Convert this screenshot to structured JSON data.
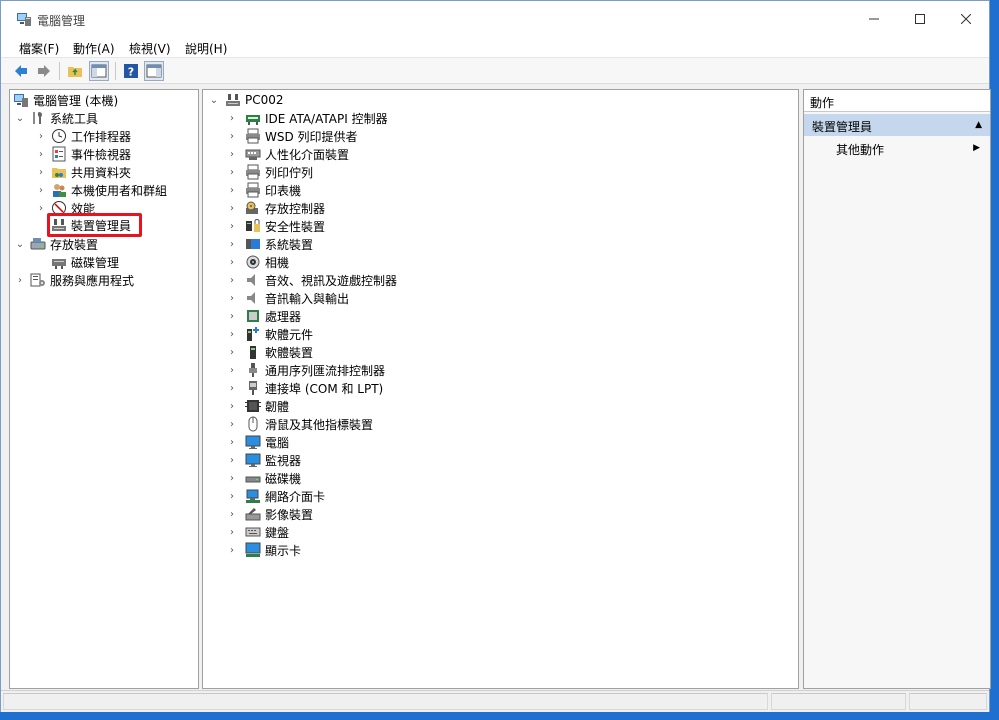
{
  "window": {
    "title": "電腦管理"
  },
  "menu": [
    "檔案(F)",
    "動作(A)",
    "檢視(V)",
    "說明(H)"
  ],
  "toolbar": {
    "buttons": [
      "back-icon",
      "forward-icon",
      "up-folder-icon",
      "show-hide-tree-icon",
      "help-icon",
      "show-hide-action-pane-icon"
    ]
  },
  "tree": {
    "root": "電腦管理 (本機)",
    "system_tools": "系統工具",
    "task_scheduler": "工作排程器",
    "event_viewer": "事件檢視器",
    "shared_folders": "共用資料夾",
    "local_users": "本機使用者和群組",
    "performance": "效能",
    "device_manager": "裝置管理員",
    "storage": "存放裝置",
    "disk_management": "磁碟管理",
    "services_apps": "服務與應用程式"
  },
  "devices": {
    "computer": "PC002",
    "items": [
      {
        "label": "IDE ATA/ATAPI 控制器",
        "icon": "ide-controller-icon"
      },
      {
        "label": "WSD 列印提供者",
        "icon": "printer-icon"
      },
      {
        "label": "人性化介面裝置",
        "icon": "hid-icon"
      },
      {
        "label": "列印佇列",
        "icon": "printer-icon"
      },
      {
        "label": "印表機",
        "icon": "printer-icon"
      },
      {
        "label": "存放控制器",
        "icon": "storage-controller-icon"
      },
      {
        "label": "安全性裝置",
        "icon": "security-device-icon"
      },
      {
        "label": "系統裝置",
        "icon": "system-device-icon"
      },
      {
        "label": "相機",
        "icon": "camera-icon"
      },
      {
        "label": "音效、視訊及遊戲控制器",
        "icon": "speaker-icon"
      },
      {
        "label": "音訊輸入與輸出",
        "icon": "speaker-icon"
      },
      {
        "label": "處理器",
        "icon": "processor-icon"
      },
      {
        "label": "軟體元件",
        "icon": "software-component-icon"
      },
      {
        "label": "軟體裝置",
        "icon": "software-device-icon"
      },
      {
        "label": "通用序列匯流排控制器",
        "icon": "usb-icon"
      },
      {
        "label": "連接埠 (COM 和 LPT)",
        "icon": "port-icon"
      },
      {
        "label": "韌體",
        "icon": "firmware-icon"
      },
      {
        "label": "滑鼠及其他指標裝置",
        "icon": "mouse-icon"
      },
      {
        "label": "電腦",
        "icon": "monitor-icon"
      },
      {
        "label": "監視器",
        "icon": "monitor-icon"
      },
      {
        "label": "磁碟機",
        "icon": "disk-drive-icon"
      },
      {
        "label": "網路介面卡",
        "icon": "network-adapter-icon"
      },
      {
        "label": "影像裝置",
        "icon": "imaging-device-icon"
      },
      {
        "label": "鍵盤",
        "icon": "keyboard-icon"
      },
      {
        "label": "顯示卡",
        "icon": "display-adapter-icon"
      }
    ]
  },
  "actions": {
    "header": "動作",
    "section": "裝置管理員",
    "more": "其他動作"
  },
  "colors": {
    "selection_highlight": "#e8131f",
    "action_section_bg": "#c4d7ec",
    "desktop": "#1f6fd1"
  }
}
